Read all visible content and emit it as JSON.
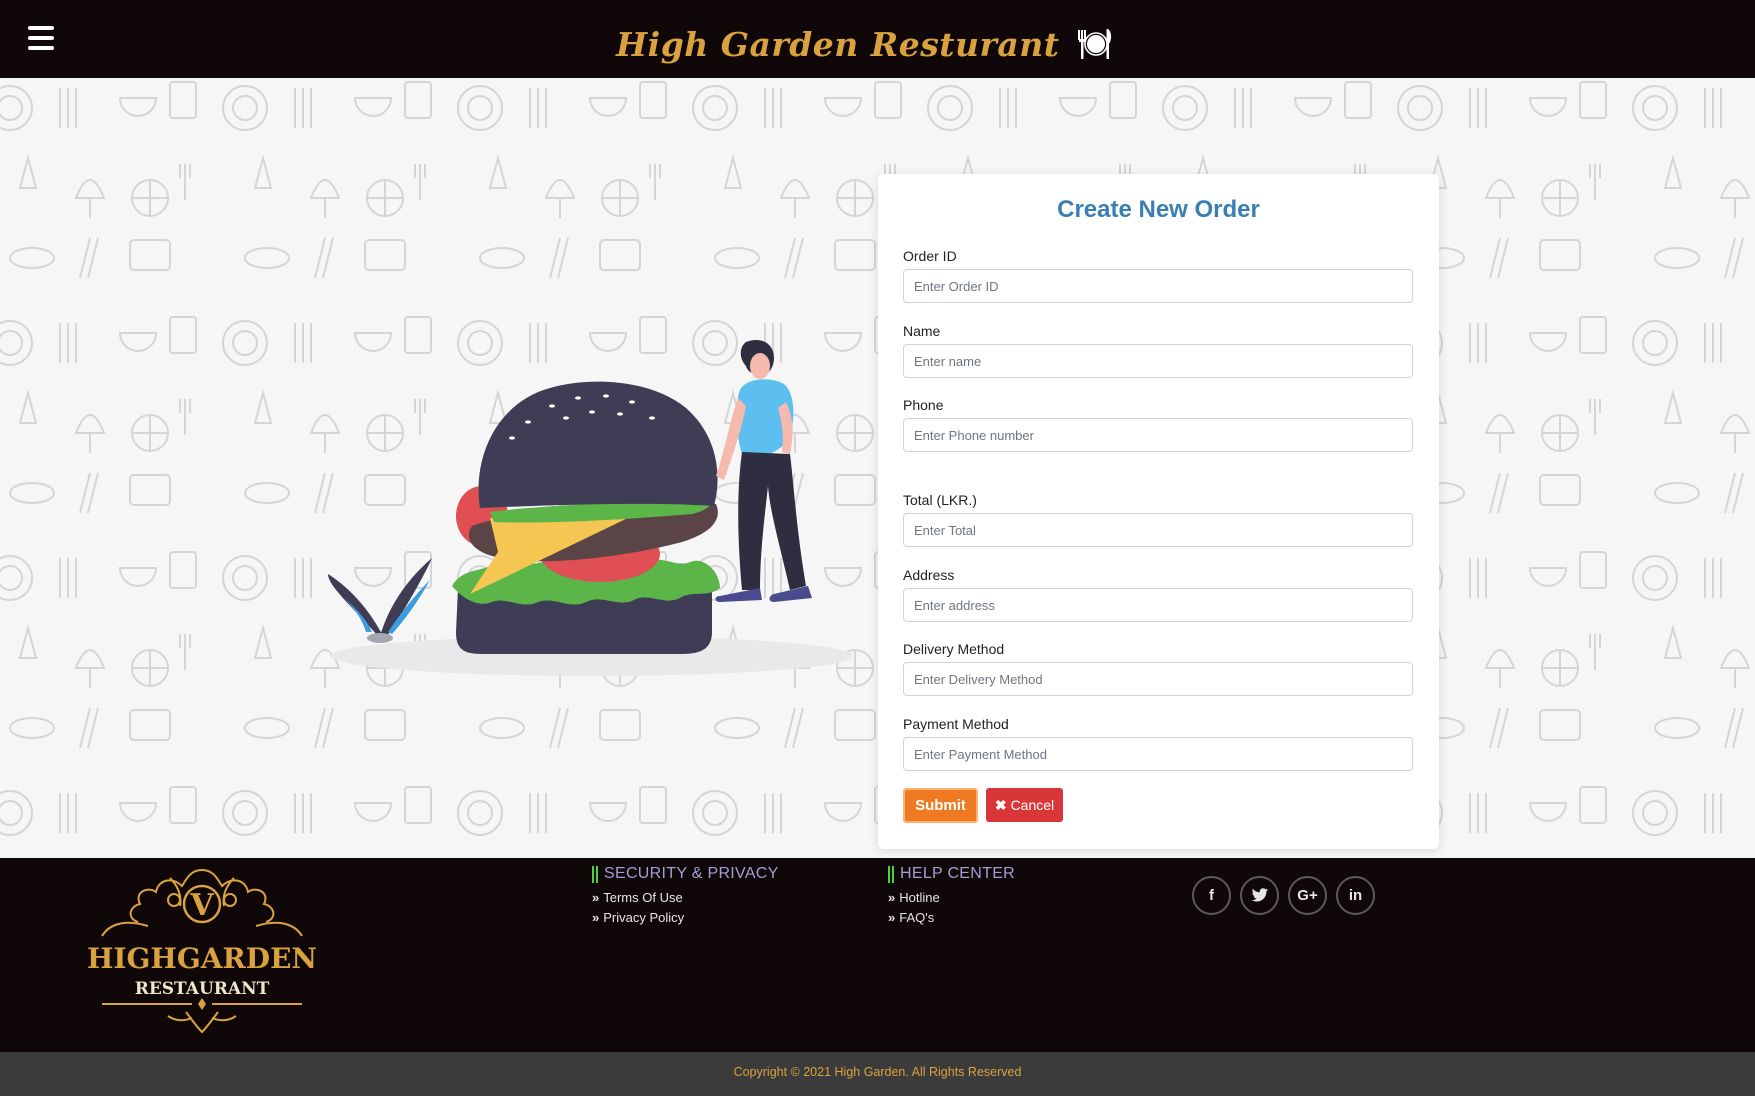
{
  "header": {
    "brand": "High Garden Resturant",
    "menu_icon": "hamburger-menu-icon",
    "brand_icon": "plate-cutlery-icon"
  },
  "form": {
    "title": "Create New Order",
    "fields": [
      {
        "label": "Order ID",
        "placeholder": "Enter Order ID",
        "value": ""
      },
      {
        "label": "Name",
        "placeholder": "Enter name",
        "value": ""
      },
      {
        "label": "Phone",
        "placeholder": "Enter Phone number",
        "value": ""
      },
      {
        "label": "Total (LKR.)",
        "placeholder": "Enter Total",
        "value": ""
      },
      {
        "label": "Address",
        "placeholder": "Enter address",
        "value": ""
      },
      {
        "label": "Delivery Method",
        "placeholder": "Enter Delivery Method",
        "value": ""
      },
      {
        "label": "Payment Method",
        "placeholder": "Enter Payment Method",
        "value": ""
      }
    ],
    "submit_label": "Submit",
    "cancel_label": "Cancel",
    "cancel_icon": "close-icon"
  },
  "footer": {
    "logo": {
      "initial": "V",
      "line1": "HIGHGARDEN",
      "line2": "RESTAURANT"
    },
    "security": {
      "heading": "SECURITY & PRIVACY",
      "links": [
        "Terms Of Use",
        "Privacy Policy"
      ]
    },
    "help": {
      "heading": "HELP CENTER",
      "links": [
        "Hotline",
        "FAQ's"
      ]
    },
    "socials": [
      {
        "name": "facebook-icon",
        "glyph": "f"
      },
      {
        "name": "twitter-icon",
        "glyph": "t"
      },
      {
        "name": "google-plus-icon",
        "glyph": "G+"
      },
      {
        "name": "linkedin-icon",
        "glyph": "in"
      }
    ],
    "copyright": "Copyright © 2021 High Garden. All Rights Reserved"
  },
  "colors": {
    "header_bg": "#0f0708",
    "brand_gold": "#d9a23f",
    "title_blue": "#3a7fb4",
    "submit_orange": "#f07a22",
    "cancel_red": "#d93638",
    "accent_green": "#4cd43a",
    "footer_heading": "#9ea0d8"
  }
}
